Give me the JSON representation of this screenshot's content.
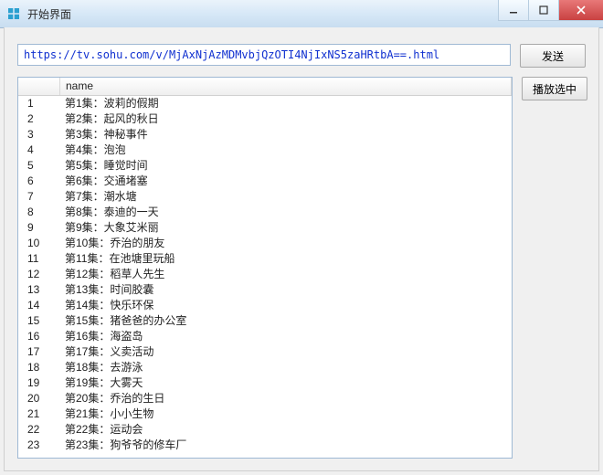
{
  "window": {
    "title": "开始界面"
  },
  "url_input": {
    "value": "https://tv.sohu.com/v/MjAxNjAzMDMvbjQzOTI4NjIxNS5zaHRtbA==.html"
  },
  "buttons": {
    "send": "发送",
    "play_selected": "播放选中"
  },
  "columns": {
    "index": "",
    "name": "name"
  },
  "episodes": [
    {
      "idx": "1",
      "name": "第1集：波莉的假期"
    },
    {
      "idx": "2",
      "name": "第2集：起风的秋日"
    },
    {
      "idx": "3",
      "name": "第3集：神秘事件"
    },
    {
      "idx": "4",
      "name": "第4集：泡泡"
    },
    {
      "idx": "5",
      "name": "第5集：睡觉时间"
    },
    {
      "idx": "6",
      "name": "第6集：交通堵塞"
    },
    {
      "idx": "7",
      "name": "第7集：潮水塘"
    },
    {
      "idx": "8",
      "name": "第8集：泰迪的一天"
    },
    {
      "idx": "9",
      "name": "第9集：大象艾米丽"
    },
    {
      "idx": "10",
      "name": "第10集：乔治的朋友"
    },
    {
      "idx": "11",
      "name": "第11集：在池塘里玩船"
    },
    {
      "idx": "12",
      "name": "第12集：稻草人先生"
    },
    {
      "idx": "13",
      "name": "第13集：时间胶囊"
    },
    {
      "idx": "14",
      "name": "第14集：快乐环保"
    },
    {
      "idx": "15",
      "name": "第15集：猪爸爸的办公室"
    },
    {
      "idx": "16",
      "name": "第16集：海盗岛"
    },
    {
      "idx": "17",
      "name": "第17集：义卖活动"
    },
    {
      "idx": "18",
      "name": "第18集：去游泳"
    },
    {
      "idx": "19",
      "name": "第19集：大雾天"
    },
    {
      "idx": "20",
      "name": "第20集：乔治的生日"
    },
    {
      "idx": "21",
      "name": "第21集：小小生物"
    },
    {
      "idx": "22",
      "name": "第22集：运动会"
    },
    {
      "idx": "23",
      "name": "第23集：狗爷爷的修车厂"
    }
  ]
}
